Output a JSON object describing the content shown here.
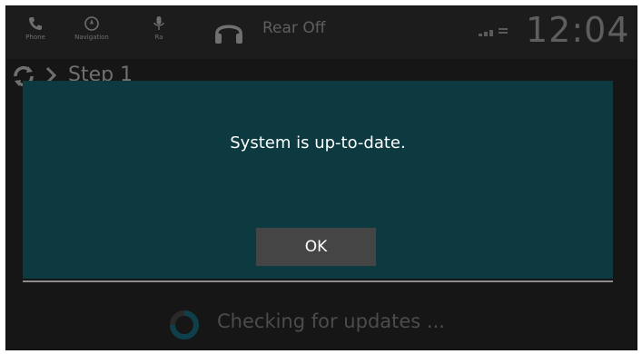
{
  "status_bar": {
    "phone_label": "Phone",
    "nav_label": "Navigation",
    "mic_label": "Ra",
    "rear_label": "Rear Off",
    "clock": "12:04"
  },
  "step": {
    "label": "Step 1"
  },
  "dialog": {
    "message": "System is up-to-date.",
    "ok_label": "OK"
  },
  "footer": {
    "status_text": "Checking for updates ..."
  },
  "colors": {
    "dialog_bg": "#0d3a40",
    "button_bg": "#454545",
    "screen_bg": "#161616"
  },
  "icons": [
    "phone-icon",
    "navigation-icon",
    "microphone-icon",
    "headphones-icon",
    "signal-icon",
    "sync-icon",
    "chevron-right-icon",
    "spinner-icon"
  ]
}
